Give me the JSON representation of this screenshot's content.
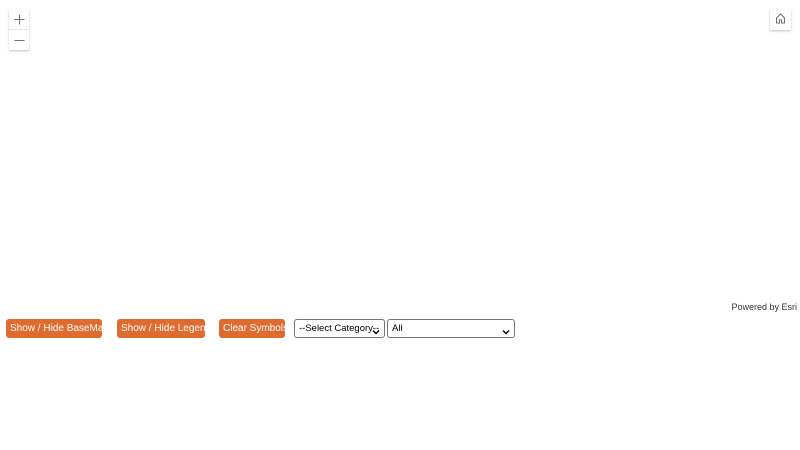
{
  "map": {
    "attribution": "Powered by Esri"
  },
  "icons": {
    "zoom_in": "plus-icon",
    "zoom_out": "minus-icon",
    "home": "home-icon",
    "dropdown": "chevron-down-icon"
  },
  "toolbar": {
    "basemap_label": "Show / Hide BaseMap",
    "legend_label": "Show / Hide Legend",
    "clear_label": "Clear Symbols",
    "category_select": "--Select Category--",
    "subcategory_select": "All"
  },
  "colors": {
    "button_bg": "#e06b2f",
    "button_text": "#ffffff",
    "map_bg": "#ffffff"
  }
}
